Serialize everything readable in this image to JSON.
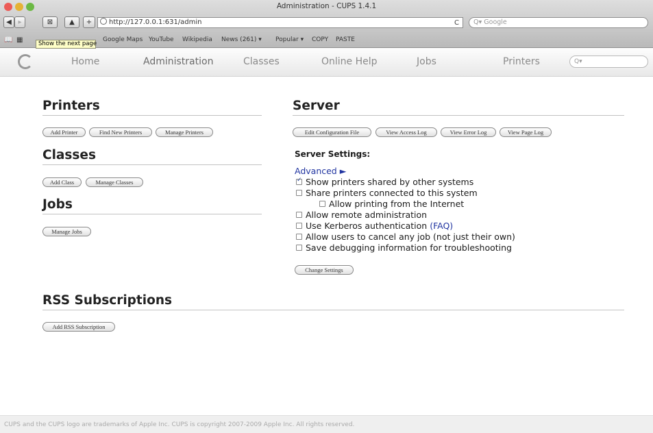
{
  "window": {
    "title": "Administration - CUPS 1.4.1",
    "traffic_lights": [
      "#ec5b57",
      "#e5b235",
      "#6cb944"
    ]
  },
  "toolbar": {
    "back_label": "◀",
    "forward_label": "▸",
    "snapshot_label": "⊠",
    "bookmark_label": "▲",
    "add_label": "+",
    "url": "http://127.0.0.1:631/admin",
    "reload_label": "C",
    "search_placeholder": "Q▾ Google"
  },
  "bookmarks": {
    "items": [
      "Google Maps",
      "YouTube",
      "Wikipedia",
      "News (261) ▾",
      "Popular ▾",
      "COPY",
      "PASTE"
    ],
    "tooltip": "Show the next page"
  },
  "nav": {
    "tabs": [
      "Home",
      "Administration",
      "Classes",
      "Online Help",
      "Jobs",
      "Printers"
    ],
    "search_placeholder": "Q▾"
  },
  "printers": {
    "heading": "Printers",
    "buttons": [
      "Add Printer",
      "Find New Printers",
      "Manage Printers"
    ]
  },
  "classes": {
    "heading": "Classes",
    "buttons": [
      "Add Class",
      "Manage Classes"
    ]
  },
  "jobs": {
    "heading": "Jobs",
    "buttons": [
      "Manage Jobs"
    ]
  },
  "server": {
    "heading": "Server",
    "buttons": [
      "Edit Configuration File",
      "View Access Log",
      "View Error Log",
      "View Page Log"
    ],
    "settings_heading": "Server Settings:",
    "advanced_link": "Advanced ►",
    "options": [
      {
        "label": "Show printers shared by other systems",
        "checked": true
      },
      {
        "label": "Share printers connected to this system",
        "checked": false
      },
      {
        "label": "Allow printing from the Internet",
        "checked": false
      },
      {
        "label": "Allow remote administration",
        "checked": false
      },
      {
        "label": "Use Kerberos authentication",
        "checked": false,
        "link": "(FAQ)"
      },
      {
        "label": "Allow users to cancel any job (not just their own)",
        "checked": false
      },
      {
        "label": "Save debugging information for troubleshooting",
        "checked": false
      }
    ],
    "change_button": "Change Settings"
  },
  "rss": {
    "heading": "RSS Subscriptions",
    "button": "Add RSS Subscription"
  },
  "footer": {
    "text": "CUPS and the CUPS logo are trademarks of Apple Inc. CUPS is copyright 2007-2009 Apple Inc. All rights reserved."
  }
}
